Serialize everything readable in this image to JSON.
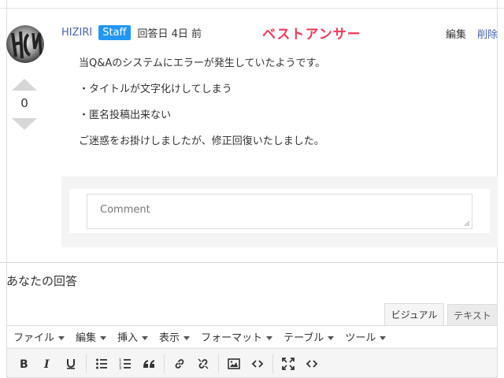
{
  "answer": {
    "author": "HIZIRI",
    "badge": "Staff",
    "answered": "回答日 4日 前",
    "best_answer": "ベストアンサー",
    "edit": "編集",
    "delete": "削除",
    "votes": "0",
    "paragraphs": [
      "当Q&Aのシステムにエラーが発生していたようです。",
      "・タイトルが文字化けしてしまう",
      "・匿名投稿出来ない",
      "ご迷惑をお掛けしましたが、修正回復いたしました。"
    ],
    "comment_placeholder": "Comment"
  },
  "your_answer": {
    "heading": "あなたの回答",
    "tabs": [
      "ビジュアル",
      "テキスト"
    ],
    "menu": [
      "ファイル",
      "編集",
      "挿入",
      "表示",
      "フォーマット",
      "テーブル",
      "ツール"
    ]
  },
  "colors": {
    "link": "#4a63b4",
    "badge": "#2196f3",
    "best_answer": "#ee3b5a"
  },
  "icons": [
    "bold-icon",
    "italic-icon",
    "underline-icon",
    "bullet-list-icon",
    "numbered-list-icon",
    "blockquote-icon",
    "link-icon",
    "unlink-icon",
    "image-icon",
    "code-icon",
    "fullscreen-icon",
    "source-code-icon"
  ]
}
